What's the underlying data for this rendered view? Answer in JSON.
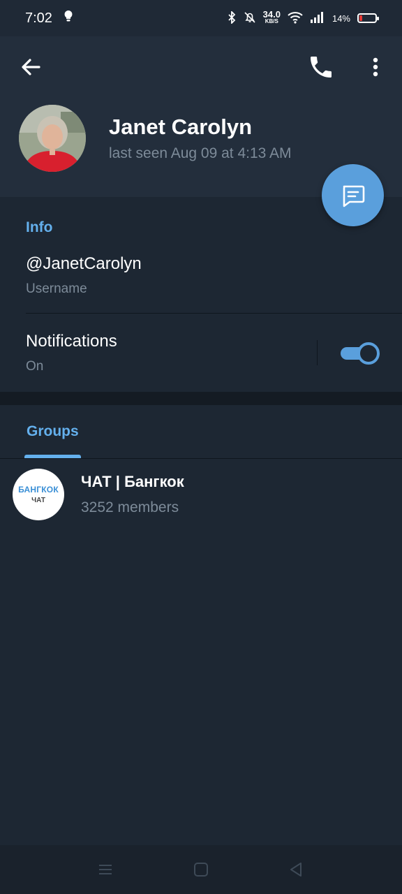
{
  "status_bar": {
    "time": "7:02",
    "net_speed_value": "34.0",
    "net_speed_unit": "KB/S",
    "battery": "14%"
  },
  "profile": {
    "name": "Janet Carolyn",
    "last_seen": "last seen Aug 09 at 4:13 AM"
  },
  "info": {
    "title": "Info",
    "username": "@JanetCarolyn",
    "username_label": "Username",
    "notifications_label": "Notifications",
    "notifications_value": "On"
  },
  "groups": {
    "tab_label": "Groups",
    "items": [
      {
        "name": "ЧАТ | Бангкок",
        "members": "3252 members",
        "avatar_line1": "БАНГКОК",
        "avatar_line2": "ЧАТ"
      }
    ]
  },
  "colors": {
    "accent": "#64b0ed",
    "fab": "#5a9fdc",
    "background": "#1d2733",
    "header": "#232e3c"
  }
}
